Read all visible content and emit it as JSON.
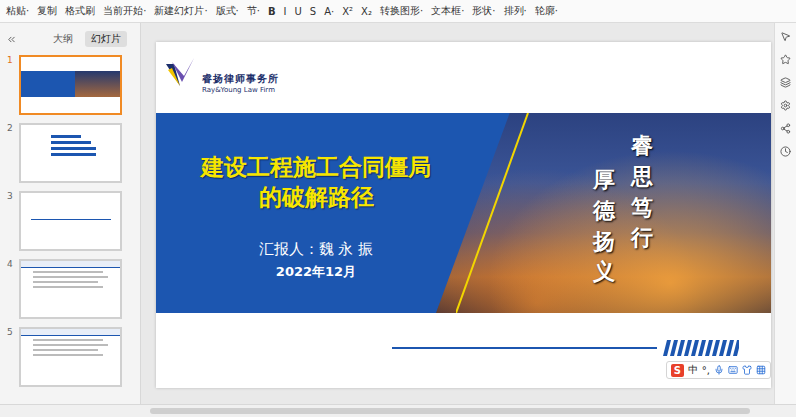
{
  "toolbar": {
    "items": [
      "粘贴·",
      "复制",
      "格式刷",
      "当前开始·",
      "新建幻灯片·",
      "版式·",
      "节·",
      "B",
      "I",
      "U",
      "S",
      "A·",
      "X²",
      "X₂",
      "转换图形·",
      "文本框·",
      "形状·",
      "排列·",
      "轮廓·"
    ]
  },
  "sidebar": {
    "tabs": [
      {
        "label": "大纲",
        "selected": false
      },
      {
        "label": "幻灯片",
        "selected": true
      }
    ],
    "slides": [
      {
        "number": "1",
        "selected": true,
        "kind": "title"
      },
      {
        "number": "2",
        "selected": false,
        "kind": "toc"
      },
      {
        "number": "3",
        "selected": false,
        "kind": "section"
      },
      {
        "number": "4",
        "selected": false,
        "kind": "text"
      },
      {
        "number": "5",
        "selected": false,
        "kind": "text"
      }
    ]
  },
  "slide": {
    "firm_name": "睿扬律师事务所",
    "firm_name_en": "Ray&Young Law Firm",
    "title_lines": [
      "建设工程施工合同僵局",
      "的破解路径"
    ],
    "reporter": "汇报人：魏 永 振",
    "date": "2022年12月",
    "mottos": [
      "厚德扬义",
      "睿思笃行"
    ]
  },
  "ime": {
    "logo": "S",
    "items": [
      "中",
      "°,"
    ]
  }
}
